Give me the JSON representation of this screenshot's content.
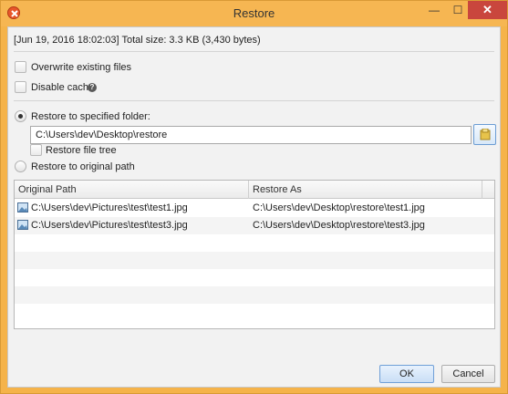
{
  "window": {
    "title": "Restore",
    "minimize_glyph": "—",
    "maximize_glyph": "☐",
    "close_glyph": "✕"
  },
  "info": {
    "date": "[Jun 19, 2016 18:02:03]",
    "size": "Total size: 3.3 KB (3,430 bytes)"
  },
  "options": {
    "overwrite_label": "Overwrite existing files",
    "overwrite_checked": false,
    "disable_cache_label": "Disable cache",
    "help_glyph": "?",
    "disable_cache_checked": false
  },
  "restore_target": {
    "specified_folder_label": "Restore to specified folder:",
    "specified_folder_selected": true,
    "folder_value": "C:\\Users\\dev\\Desktop\\restore",
    "restore_tree_label": "Restore file tree",
    "restore_tree_checked": false,
    "original_path_label": "Restore to original path",
    "original_path_selected": false
  },
  "table": {
    "columns": [
      "Original Path",
      "Restore As"
    ],
    "rows": [
      {
        "original": "C:\\Users\\dev\\Pictures\\test\\test1.jpg",
        "restore_as": "C:\\Users\\dev\\Desktop\\restore\\test1.jpg"
      },
      {
        "original": "C:\\Users\\dev\\Pictures\\test\\test3.jpg",
        "restore_as": "C:\\Users\\dev\\Desktop\\restore\\test3.jpg"
      }
    ]
  },
  "buttons": {
    "ok_label": "OK",
    "cancel_label": "Cancel"
  },
  "icons": {
    "app": "app-restore-icon",
    "help": "help-icon",
    "browse": "folder-icon",
    "file": "image-file-icon"
  },
  "colors": {
    "title_bar": "#f6b652",
    "close_button": "#c9463d",
    "accent_button": "#c9def6"
  }
}
